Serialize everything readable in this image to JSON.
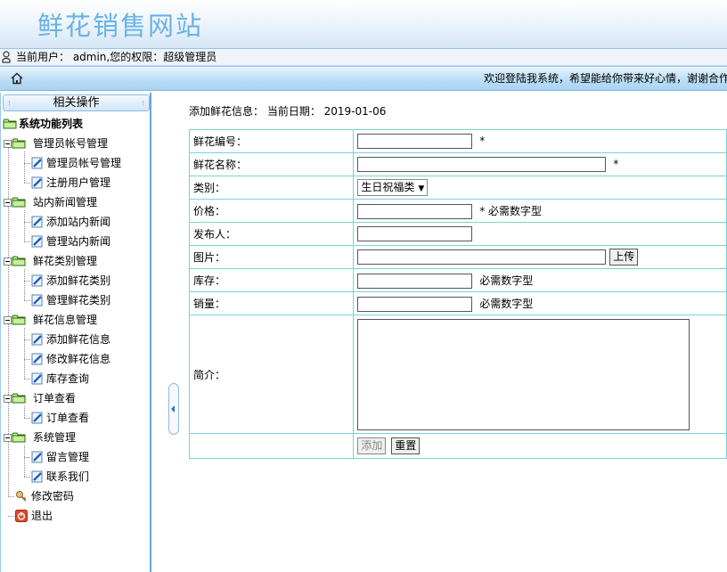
{
  "header": {
    "site_title": "鲜花销售网站",
    "user_info": "当前用户： admin,您的权限：超级管理员",
    "welcome": "欢迎登陆我系统，希望能给你带来好心情，谢谢合作"
  },
  "sidebar": {
    "title": "相关操作",
    "root_label": "系统功能列表",
    "groups": [
      {
        "label": "管理员帐号管理",
        "items": [
          "管理员帐号管理",
          "注册用户管理"
        ]
      },
      {
        "label": "站内新闻管理",
        "items": [
          "添加站内新闻",
          "管理站内新闻"
        ]
      },
      {
        "label": "鲜花类别管理",
        "items": [
          "添加鲜花类别",
          "管理鲜花类别"
        ]
      },
      {
        "label": "鲜花信息管理",
        "items": [
          "添加鲜花信息",
          "修改鲜花信息",
          "库存查询"
        ]
      },
      {
        "label": "订单查看",
        "items": [
          "订单查看"
        ]
      },
      {
        "label": "系统管理",
        "items": [
          "留言管理",
          "联系我们"
        ]
      }
    ],
    "change_password": "修改密码",
    "logout": "退出"
  },
  "main": {
    "title": "添加鲜花信息： 当前日期： 2019-01-06",
    "form": {
      "code_label": "鲜花编号：",
      "code_value": "",
      "code_note": "*",
      "name_label": "鲜花名称：",
      "name_value": "",
      "name_note": "*",
      "category_label": "类别：",
      "category_value": "生日祝福类",
      "price_label": "价格：",
      "price_value": "",
      "price_note": "* 必需数字型",
      "publisher_label": "发布人：",
      "publisher_value": "",
      "image_label": "图片：",
      "image_value": "",
      "upload_label": "上传",
      "stock_label": "库存：",
      "stock_value": "",
      "stock_note": "必需数字型",
      "sales_label": "销量：",
      "sales_value": "",
      "sales_note": "必需数字型",
      "intro_label": "简介：",
      "intro_value": "",
      "submit_label": "添加",
      "reset_label": "重置"
    }
  },
  "colors": {
    "site_title": "#69b2e6",
    "table_border": "#74d4dc",
    "sidebar_border": "#6aa6d6",
    "folder": "#9bd36a"
  }
}
